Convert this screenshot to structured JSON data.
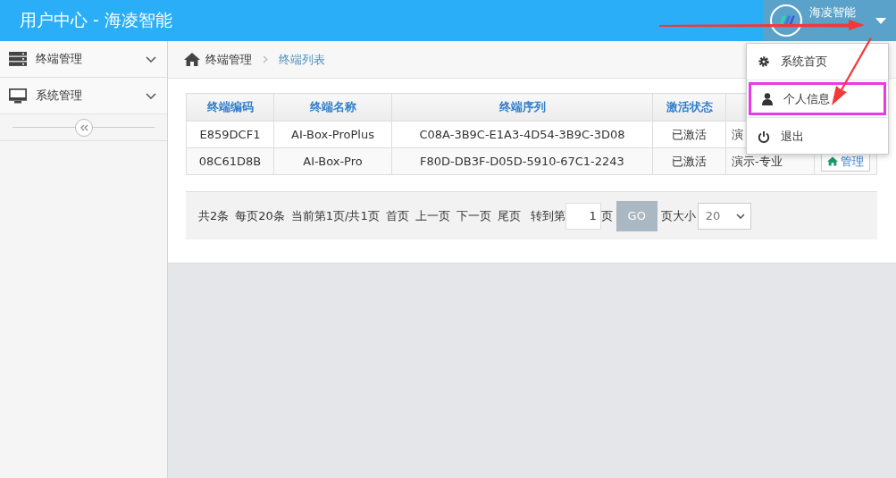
{
  "header": {
    "title": "用户中心 - 海凌智能",
    "user_name": "海凌智能"
  },
  "user_menu": {
    "items": [
      {
        "label": "系统首页",
        "highlighted": false
      },
      {
        "label": "个人信息",
        "highlighted": true
      },
      {
        "label": "退出",
        "highlighted": false
      }
    ]
  },
  "sidebar": {
    "items": [
      {
        "label": "终端管理"
      },
      {
        "label": "系统管理"
      }
    ]
  },
  "breadcrumb": [
    "终端管理",
    "终端列表"
  ],
  "table": {
    "columns": [
      "终端编码",
      "终端名称",
      "终端序列",
      "激活状态"
    ],
    "rows": [
      {
        "cells": [
          "E859DCF1",
          "AI-Box-ProPlus",
          "C08A-3B9C-E1A3-4D54-3B9C-3D08",
          "已激活",
          "演"
        ]
      },
      {
        "cells": [
          "08C61D8B",
          "AI-Box-Pro",
          "F80D-DB3F-D05D-5910-67C1-2243",
          "已激活",
          "演示-专业"
        ],
        "action": "管理"
      }
    ]
  },
  "pager": {
    "info": [
      "共2条",
      "每页20条",
      "当前第1页/共1页"
    ],
    "links": [
      "首页",
      "上一页",
      "下一页",
      "尾页"
    ],
    "goto_label": "转到第",
    "page_value": "1",
    "page_suffix": "页",
    "go_button": "GO",
    "size_label": "页大小",
    "size_value": "20"
  }
}
